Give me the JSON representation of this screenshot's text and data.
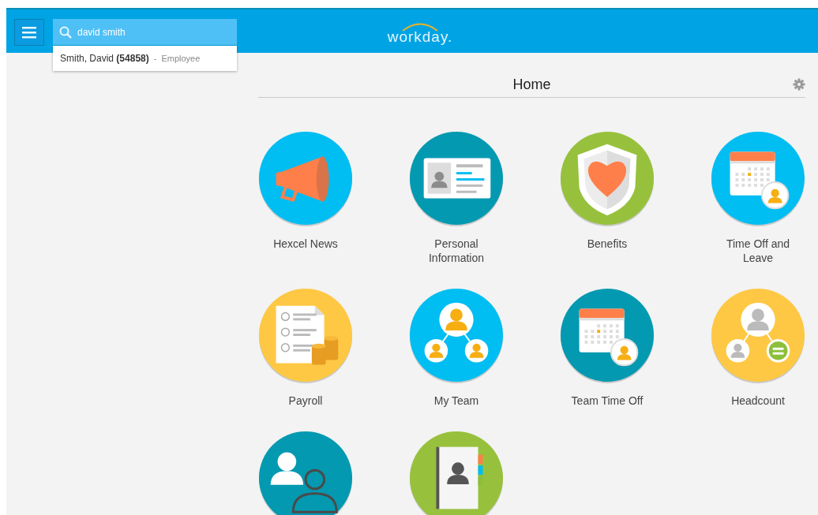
{
  "header": {
    "search": {
      "value": "david smith"
    },
    "search_results": [
      {
        "name": "Smith, David **(54858)**",
        "separator": "-",
        "type": "Employee"
      }
    ],
    "logo": "workday."
  },
  "page": {
    "title": "Home"
  },
  "apps": [
    {
      "label": "Hexcel News",
      "kind": "megaphone",
      "color": "#00bdf2"
    },
    {
      "label": "Personal Information",
      "kind": "idcard",
      "color": "#0399b1"
    },
    {
      "label": "Benefits",
      "kind": "shield",
      "color": "#97c13c"
    },
    {
      "label": "Time Off and Leave",
      "kind": "calendar",
      "color": "#00bdf2"
    },
    {
      "label": "Payroll",
      "kind": "payroll",
      "color": "#fec844"
    },
    {
      "label": "My Team",
      "kind": "team",
      "color": "#00bdf2"
    },
    {
      "label": "Team Time Off",
      "kind": "calendar",
      "color": "#0399b1"
    },
    {
      "label": "Headcount",
      "kind": "headcount",
      "color": "#fec844"
    },
    {
      "kind": "people",
      "color": "#0399b1"
    },
    {
      "kind": "directory",
      "color": "#97c13c"
    }
  ]
}
